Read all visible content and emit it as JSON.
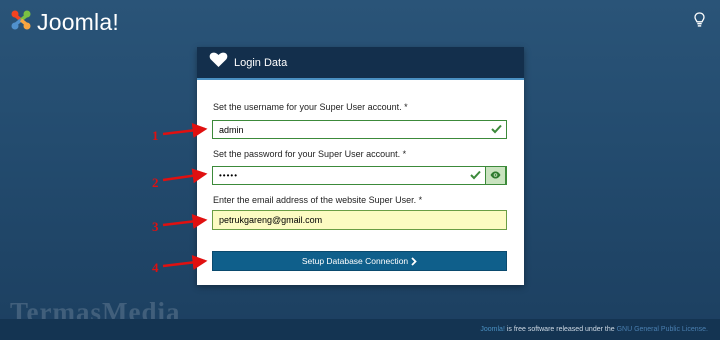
{
  "header": {
    "brand": "Joomla!",
    "logo_icon": "joomla-logo-icon",
    "help_icon": "lightbulb-icon"
  },
  "card": {
    "title": "Login Data",
    "title_icon": "heart-icon",
    "username": {
      "label": "Set the username for your Super User account. *",
      "value": "admin",
      "valid": true
    },
    "password": {
      "label": "Set the password for your Super User account. *",
      "value": "•••••",
      "valid": true,
      "toggle_icon": "eye-icon"
    },
    "email": {
      "label": "Enter the email address of the website Super User. *",
      "value": "petrukgareng@gmail.com"
    },
    "submit": {
      "label": "Setup Database Connection",
      "icon": "chevron-right-icon"
    }
  },
  "annotations": [
    "1",
    "2",
    "3",
    "4"
  ],
  "watermark": "TermasMedia",
  "footer": {
    "product": "Joomla!",
    "text": " is free software released under the ",
    "license": "GNU General Public License."
  },
  "colors": {
    "accent": "#0f5f8b",
    "valid": "#3c8a3a",
    "annotation": "#e01010",
    "header_bg": "#132f4c"
  }
}
